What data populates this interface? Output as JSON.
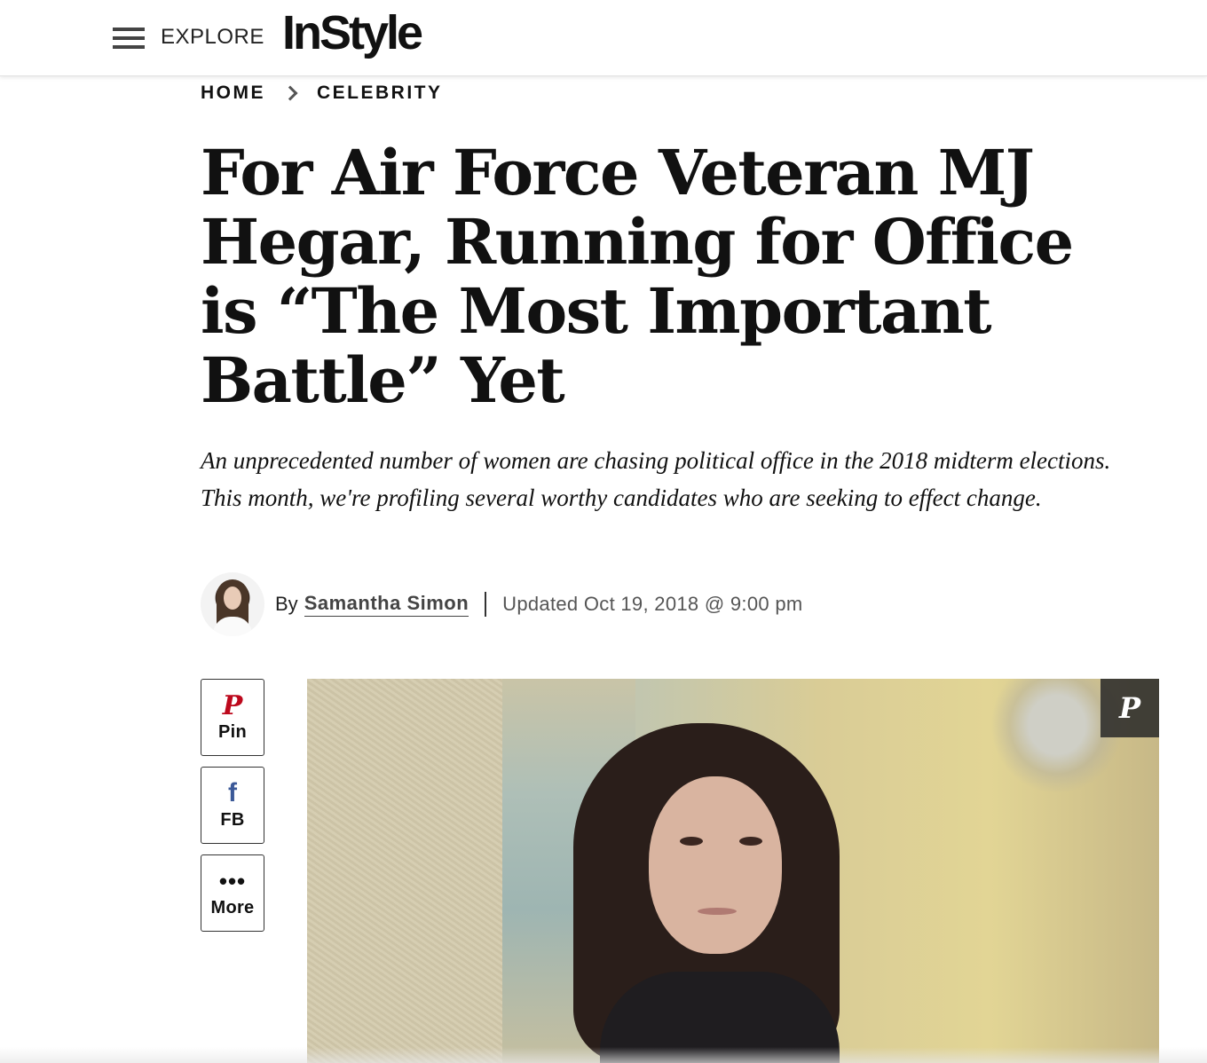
{
  "header": {
    "explore_label": "EXPLORE",
    "logo_text": "InStyle"
  },
  "breadcrumb": {
    "items": [
      "HOME",
      "CELEBRITY"
    ]
  },
  "article": {
    "title": "For Air Force Veteran MJ Hegar, Running for Office is “The Most Important Battle” Yet",
    "dek": "An unprecedented number of women are chasing political office in the 2018 midterm elections. This month, we're profiling several worthy candidates who are seeking to effect change.",
    "byline_prefix": "By",
    "author": "Samantha Simon",
    "updated": "Updated Oct 19, 2018 @ 9:00 pm"
  },
  "share": {
    "buttons": [
      {
        "label": "Pin",
        "icon": "pinterest-icon",
        "color": "#bd081c"
      },
      {
        "label": "FB",
        "icon": "facebook-icon",
        "color": "#3b5998"
      },
      {
        "label": "More",
        "icon": "more-dots-icon",
        "color": "#111111"
      }
    ]
  },
  "hero": {
    "pin_icon": "pinterest-icon"
  }
}
